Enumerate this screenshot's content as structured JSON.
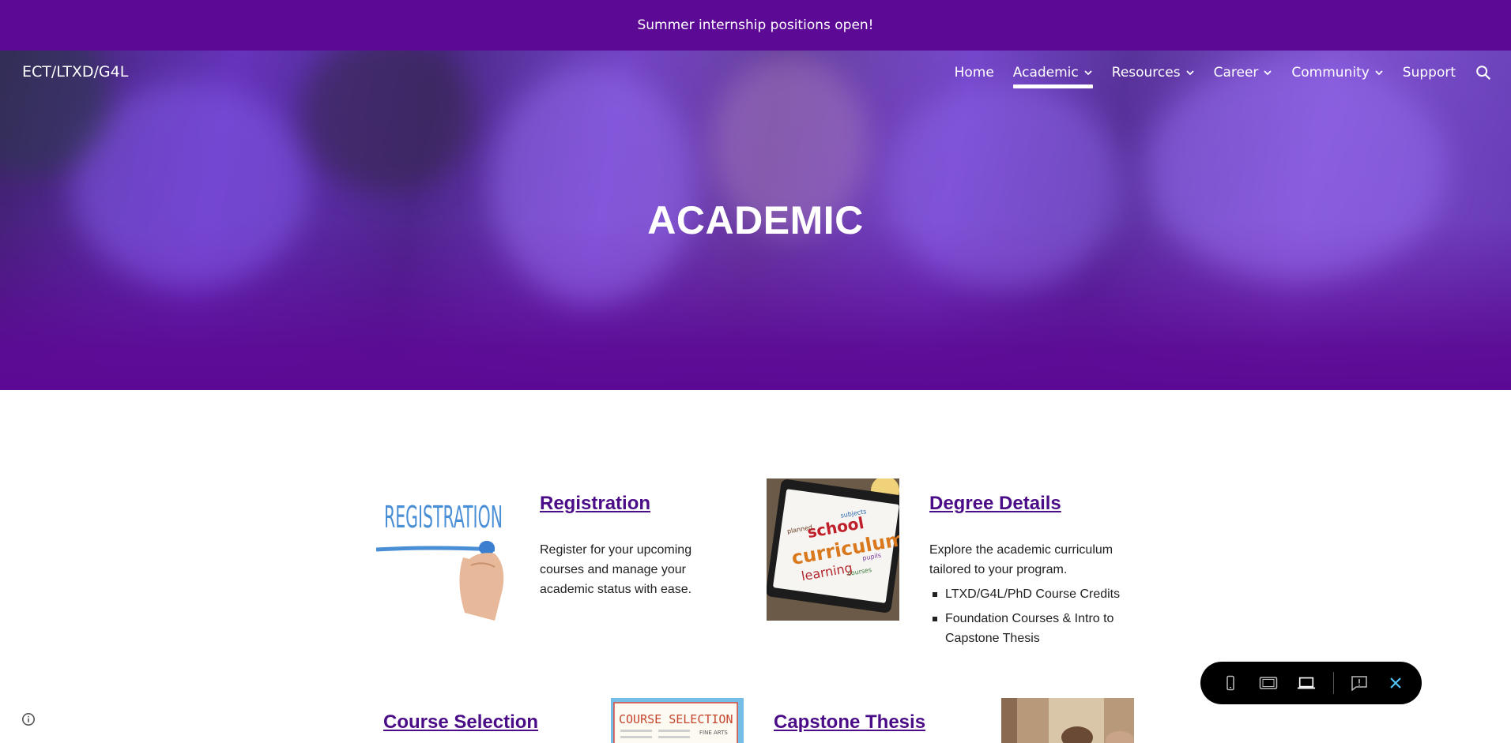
{
  "announcement": {
    "text": "Summer internship positions open!"
  },
  "site": {
    "title": "ECT/LTXD/G4L"
  },
  "nav": {
    "items": [
      {
        "label": "Home",
        "has_dropdown": false,
        "active": false
      },
      {
        "label": "Academic",
        "has_dropdown": true,
        "active": true
      },
      {
        "label": "Resources",
        "has_dropdown": true,
        "active": false
      },
      {
        "label": "Career",
        "has_dropdown": true,
        "active": false
      },
      {
        "label": "Community",
        "has_dropdown": true,
        "active": false
      },
      {
        "label": "Support",
        "has_dropdown": false,
        "active": false
      }
    ],
    "search_icon": "search-icon"
  },
  "hero": {
    "title": "ACADEMIC"
  },
  "cards": {
    "registration": {
      "title": "Registration",
      "text": "Register for your upcoming courses and manage your academic status with ease.",
      "image_text": "REGISTRATION"
    },
    "degree": {
      "title": "Degree Details",
      "text": "Explore the academic curriculum tailored to your program.",
      "bullets": [
        "LTXD/G4L/PhD Course Credits",
        "Foundation Courses & Intro to Capstone Thesis"
      ],
      "image_words": [
        "school",
        "curriculum",
        "learning",
        "planned",
        "subjects",
        "pupils",
        "courses"
      ]
    },
    "course_selection": {
      "title": "Course Selection",
      "image_text": "COURSE SELECTION",
      "image_subtext": "FINE ARTS"
    },
    "capstone": {
      "title": "Capstone Thesis"
    }
  },
  "preview_bar": {
    "icons": [
      "phone-icon",
      "tablet-icon",
      "laptop-icon",
      "feedback-icon",
      "close-icon"
    ],
    "active": "laptop-icon",
    "accent": "#4fc3f7"
  },
  "colors": {
    "brand": "#5c0a95",
    "link": "#4b0d87"
  }
}
